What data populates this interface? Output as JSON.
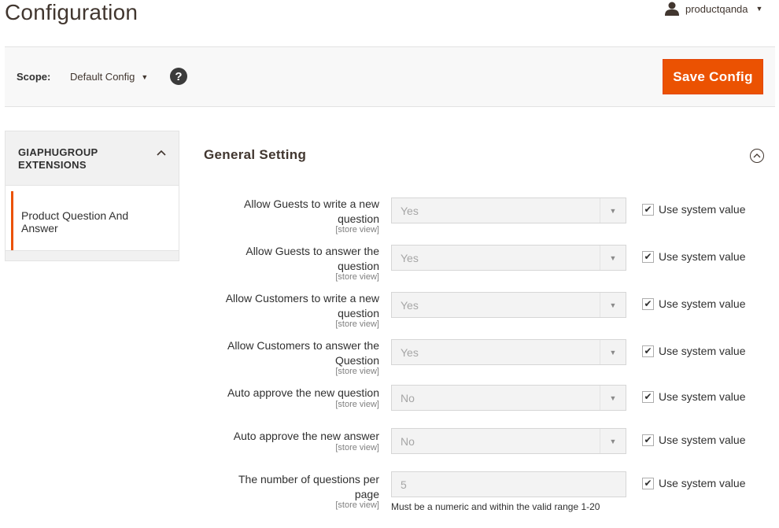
{
  "page": {
    "title": "Configuration"
  },
  "user": {
    "name": "productqanda"
  },
  "scope": {
    "label": "Scope:",
    "value": "Default Config",
    "help": "?"
  },
  "actions": {
    "save_label": "Save Config"
  },
  "sidebar": {
    "group_title_line1": "GIAPHUGROUP",
    "group_title_line2": "EXTENSIONS",
    "items": [
      {
        "label_line1": "Product Question And",
        "label_line2": "Answer"
      }
    ]
  },
  "section": {
    "title": "General Setting"
  },
  "fields": [
    {
      "label_line1": "Allow Guests to write a new",
      "label_line2": "question",
      "scope": "[store view]",
      "value": "Yes",
      "type": "select",
      "use_system": "Use system value"
    },
    {
      "label_line1": "Allow Guests to answer the",
      "label_line2": "question",
      "scope": "[store view]",
      "value": "Yes",
      "type": "select",
      "use_system": "Use system value"
    },
    {
      "label_line1": "Allow Customers to write a new",
      "label_line2": "question",
      "scope": "[store view]",
      "value": "Yes",
      "type": "select",
      "use_system": "Use system value"
    },
    {
      "label_line1": "Allow Customers to answer the",
      "label_line2": "Question",
      "scope": "[store view]",
      "value": "Yes",
      "type": "select",
      "use_system": "Use system value"
    },
    {
      "label_line1": "Auto approve the new question",
      "label_line2": "",
      "scope": "[store view]",
      "value": "No",
      "type": "select",
      "use_system": "Use system value"
    },
    {
      "label_line1": "Auto approve the new answer",
      "label_line2": "",
      "scope": "[store view]",
      "value": "No",
      "type": "select",
      "use_system": "Use system value"
    },
    {
      "label_line1": "The number of questions per",
      "label_line2": "page",
      "scope": "[store view]",
      "value": "5",
      "type": "text",
      "use_system": "Use system value",
      "note": "Must be a numeric and within the valid range 1-20"
    }
  ],
  "icons": {
    "user": "user-icon",
    "help": "help-icon",
    "collapse": "collapse-icon",
    "chevron": "chevron-up-icon"
  },
  "colors": {
    "accent": "#eb5202",
    "title": "#41362f"
  }
}
